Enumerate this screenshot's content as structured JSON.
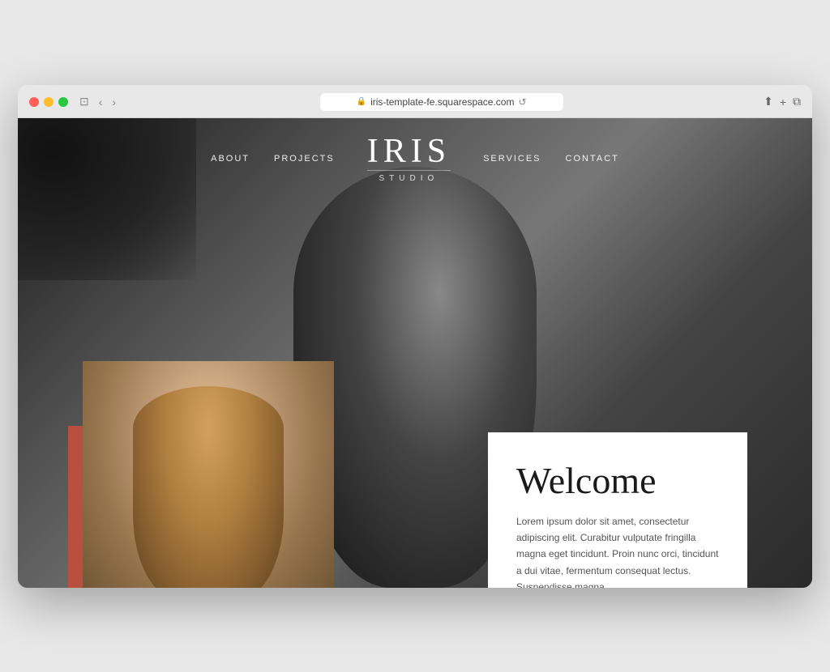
{
  "browser": {
    "url": "iris-template-fe.squarespace.com",
    "controls": {
      "back": "‹",
      "forward": "›",
      "window": "⊡",
      "refresh": "↺",
      "share": "⬆",
      "new_tab": "+",
      "duplicate": "⧉"
    }
  },
  "nav": {
    "left_links": [
      "ABOUT",
      "PROJECTS"
    ],
    "right_links": [
      "SERVICES",
      "CONTACT"
    ],
    "logo_main": "IRIS",
    "logo_sub": "STUDIO"
  },
  "hero": {
    "background_desc": "Grayscale photo of woman in overalls with wind-blown hair"
  },
  "welcome": {
    "title": "Welcome",
    "body": "Lorem ipsum dolor sit amet, consectetur adipiscing elit. Curabitur vulputate fringilla magna eget tincidunt. Proin nunc orci, tincidunt a dui vitae, fermentum consequat lectus. Suspendisse magna"
  },
  "colors": {
    "accent_red": "#b85040",
    "logo_white": "#ffffff",
    "nav_text": "rgba(255,255,255,0.9)"
  }
}
